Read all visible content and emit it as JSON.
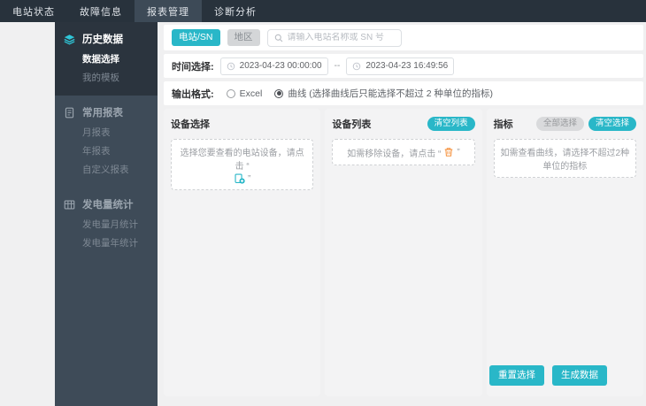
{
  "topnav": {
    "items": [
      {
        "label": "电站状态"
      },
      {
        "label": "故障信息"
      },
      {
        "label": "报表管理"
      },
      {
        "label": "诊断分析"
      }
    ]
  },
  "sidebar": {
    "groups": [
      {
        "label": "历史数据",
        "icon": "layers-icon",
        "items": [
          {
            "label": "数据选择",
            "active": true
          },
          {
            "label": "我的模板",
            "active": false
          }
        ]
      },
      {
        "label": "常用报表",
        "icon": "document-icon",
        "items": [
          {
            "label": "月报表"
          },
          {
            "label": "年报表"
          },
          {
            "label": "自定义报表"
          }
        ]
      },
      {
        "label": "发电量统计",
        "icon": "grid-icon",
        "items": [
          {
            "label": "发电量月统计"
          },
          {
            "label": "发电量年统计"
          }
        ]
      }
    ]
  },
  "search_bar": {
    "station_tab": "电站/SN",
    "region_tab": "地区",
    "placeholder": "请输入电站名称或 SN 号"
  },
  "time_row": {
    "label": "时间选择:",
    "start": "2023-04-23 00:00:00",
    "separator": "--",
    "end": "2023-04-23 16:49:56"
  },
  "format_row": {
    "label": "输出格式:",
    "excel_option": "Excel",
    "curve_option": "曲线 (选择曲线后只能选择不超过 2 种单位的指标)",
    "selected": "curve"
  },
  "panels": {
    "device_select": {
      "title": "设备选择",
      "hint_before": "选择您要查看的电站设备，请点击 “",
      "hint_after": "”"
    },
    "device_list": {
      "title": "设备列表",
      "clear_button": "清空列表",
      "hint_before": "如需移除设备，请点击 “",
      "hint_after": "”"
    },
    "indicators": {
      "title": "指标",
      "select_all_button": "全部选择",
      "clear_button": "清空选择",
      "hint": "如需查看曲线，请选择不超过2种单位的指标"
    }
  },
  "actions": {
    "reset": "重置选择",
    "generate": "生成数据"
  },
  "colors": {
    "accent_teal": "#29b7c8",
    "trash_orange": "#f5923e",
    "navbar_dark": "#28323c",
    "sidebar_dark": "#3e4b58",
    "sidebar_active_group": "#2b343e",
    "page_background": "#f0f0f1"
  }
}
